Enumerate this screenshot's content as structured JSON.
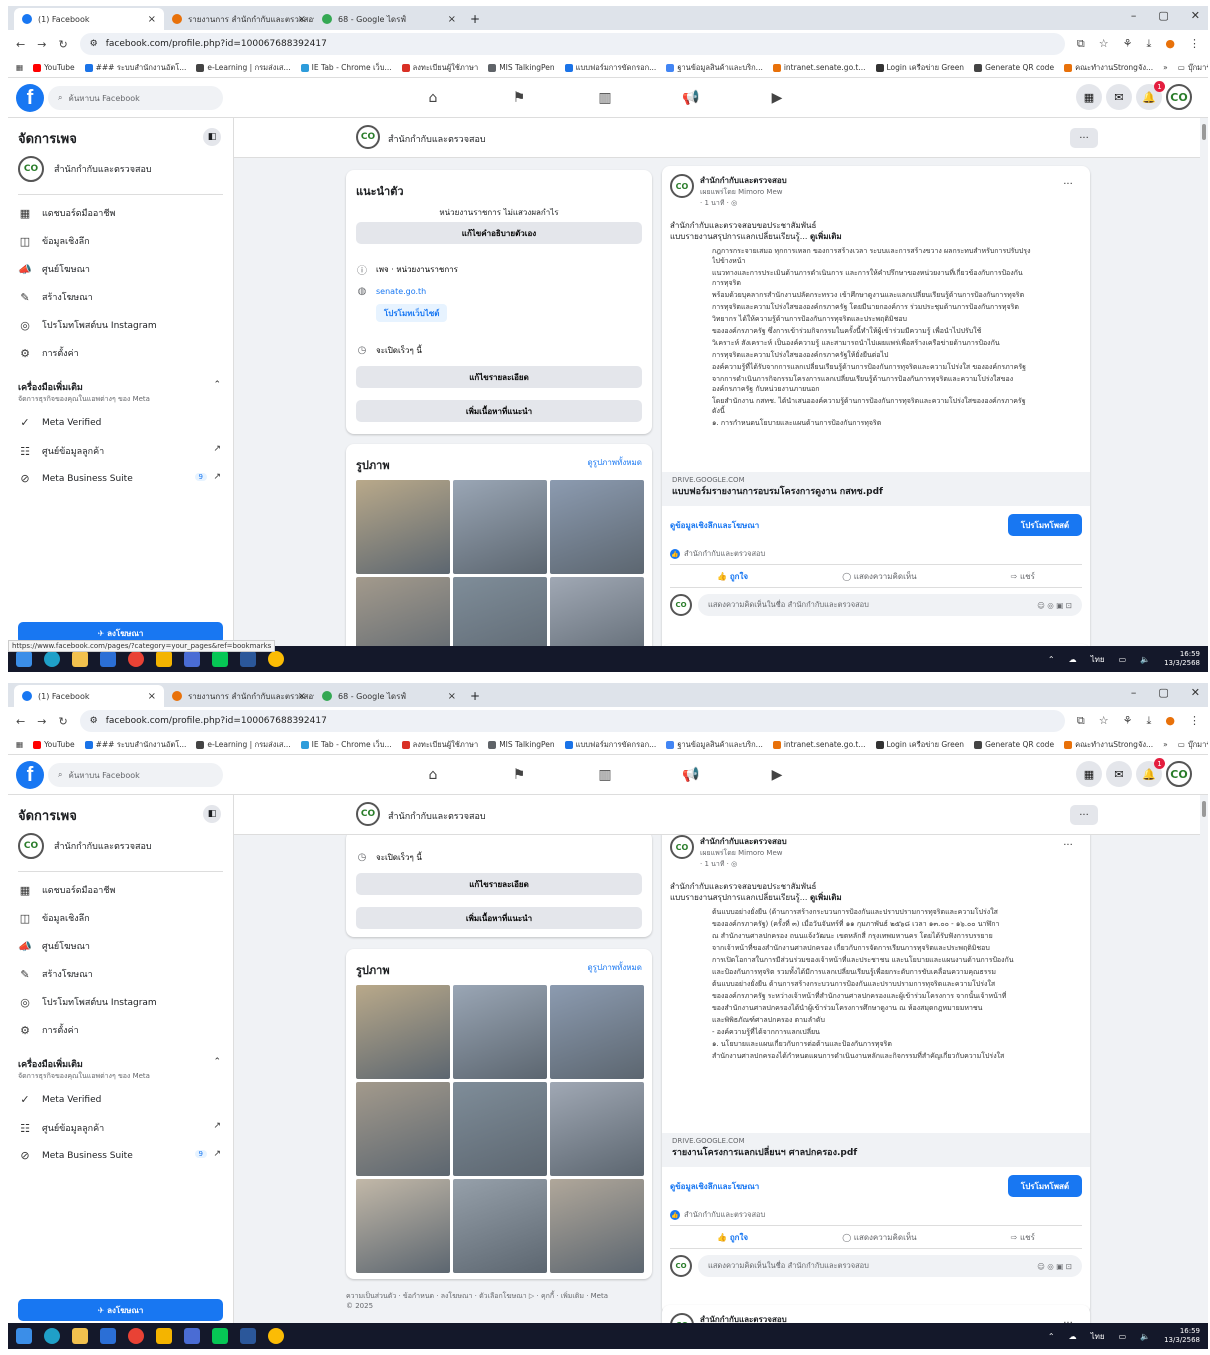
{
  "browser": {
    "tabs": [
      {
        "label": "(1) Facebook",
        "color": "#1877f2"
      },
      {
        "label": "รายงานการ สำนักกำกับและตรวจสอบ 2",
        "color": "#e8710a"
      },
      {
        "label": "68 - Google ไดรฟ์",
        "color": "#34a853"
      }
    ],
    "new_tab": "+",
    "url": "facebook.com/profile.php?id=100067688392417",
    "bookmarks": [
      "YouTube",
      "### ระบบสำนักงานอัตโ...",
      "e-Learning | กรมส่งเส...",
      "IE Tab - Chrome เว็บ...",
      "ลงทะเบียนผู้ใช้ภาษา",
      "MIS TalkingPen",
      "แบบฟอร์มการขัดกรอก...",
      "ฐานข้อมูลสินค้าและบริก...",
      "intranet.senate.go.t...",
      "Login เครือข่าย Green",
      "Generate QR code",
      "คณะทำงานStrongจัง..."
    ],
    "bm_more": "»",
    "bm_folder": "บุ๊กมาร์กทั้งหมด",
    "status_url": "https://www.facebook.com/pages/?category=your_pages&ref=bookmarks"
  },
  "fb": {
    "logo": "f",
    "search_placeholder": "ค้นหาบน Facebook",
    "notif_count": "1"
  },
  "sidebar": {
    "title": "จัดการเพจ",
    "page_name": "สำนักกำกับและตรวจสอบ",
    "items": [
      {
        "label": "แดชบอร์ดมืออาชีพ",
        "icon": "▦"
      },
      {
        "label": "ข้อมูลเชิงลึก",
        "icon": "◫"
      },
      {
        "label": "ศูนย์โฆษณา",
        "icon": "📣"
      },
      {
        "label": "สร้างโฆษณา",
        "icon": "✎"
      },
      {
        "label": "โปรโมทโพสต์บน Instagram",
        "icon": "◎"
      },
      {
        "label": "การตั้งค่า",
        "icon": "⚙"
      }
    ],
    "more_tools": "เครื่องมือเพิ่มเติม",
    "more_tools_sub": "จัดการธุรกิจของคุณในแอพต่างๆ ของ Meta",
    "tools": [
      {
        "label": "Meta Verified",
        "icon": "✓",
        "ext": ""
      },
      {
        "label": "ศูนย์ข้อมูลลูกค้า",
        "icon": "☷",
        "ext": "↗"
      },
      {
        "label": "Meta Business Suite",
        "icon": "⊘",
        "ext": "↗",
        "badge": "9"
      }
    ],
    "advertise": "ลงโฆษณา"
  },
  "intro": {
    "title": "แนะนำตัว",
    "category": "หน่วยงานราชการ ไม่แสวงผลกำไร",
    "edit_bio": "แก้ไขคำอธิบายตัวเอง",
    "page_type": "เพจ · หน่วยงานราชการ",
    "website": "senate.go.th",
    "promote_web": "โปรโมทเว็บไซต์",
    "hours": "จะเปิดเร็วๆ นี้",
    "edit_details": "แก้ไขรายละเอียด",
    "add_featured": "เพิ่มเนื้อหาที่แนะนำ"
  },
  "photos": {
    "title": "รูปภาพ",
    "see_all": "ดูรูปภาพทั้งหมด",
    "tones": [
      "#b9a98a",
      "#9aa6b5",
      "#8c9bb0",
      "#a39a8c",
      "#7f8d99",
      "#a0a8b4",
      "#c2b8a8",
      "#96a0aa",
      "#b0a79a"
    ]
  },
  "footer": {
    "links": "ความเป็นส่วนตัว · ข้อกำหนด · ลงโฆษณา · ตัวเลือกโฆษณา ▷ · คุกกี้ · เพิ่มเติม · Meta",
    "copy": "© 2025"
  },
  "posts": [
    {
      "author": "สำนักกำกับและตรวจสอบ",
      "sub": "เผยแพร่โดย Mimoro Mew",
      "time": "· 1 นาที · ◎",
      "text1": "สำนักกำกับและตรวจสอบขอประชาสัมพันธ์",
      "text2": "แบบรายงานสรุปการแลกเปลี่ยนเรียนรู้...",
      "more": "ดูเพิ่มเติม",
      "doc": [
        "กฎการกระจายเสมอ ทุกการเหลก ของการสร้างเวลา ระบบและการสร้างขวาง ผลกระทบสำหรับการปรับปรุงไปข้างหน้า",
        "แนวทางและการประเมินด้านการดำเนินการ และการให้คำปรึกษาของหน่วยงานที่เกี่ยวข้องกับการป้องกันการทุจริต",
        "พร้อมด้วยบุคลากรสำนักงานปลัดกระทรวง เข้าศึกษาดูงานและแลกเปลี่ยนเรียนรู้ด้านการป้องกันการทุจริต",
        "การทุจริตและความโปร่งใสขององค์กรภาครัฐ โดยมีนายกองค์การ ร่วมประชุมด้านการป้องกันการทุจริต",
        "วิทยากร ได้ให้ความรู้ด้านการป้องกันการทุจริตและประพฤติมิชอบ",
        "ขององค์กรภาครัฐ ซึ่งการเข้าร่วมกิจกรรมในครั้งนี้ทำให้ผู้เข้าร่วมมีความรู้ เพื่อนำไปปรับใช้",
        "วิเคราะห์ สังเคราะห์ เป็นองค์ความรู้ และสามารถนำไปเผยแพร่เพื่อสร้างเครือข่ายด้านการป้องกัน",
        "การทุจริตและความโปร่งใสขององค์กรภาครัฐให้ยั่งยืนต่อไป",
        "องค์ความรู้ที่ได้รับจากการแลกเปลี่ยนเรียนรู้ด้านการป้องกันการทุจริตและความโปร่งใส ขององค์กรภาครัฐ",
        "จากการดำเนินการกิจกรรมโครงการแลกเปลี่ยนเรียนรู้ด้านการป้องกันการทุจริตและความโปร่งใสขององค์กรภาครัฐ กับหน่วยงานภายนอก",
        "โดยสำนักงาน กสทช. ได้นำเสนอองค์ความรู้ด้านการป้องกันการทุจริตและความโปร่งใสขององค์กรภาครัฐ ดังนี้",
        "๑. การกำหนดนโยบายและแผนด้านการป้องกันการทุจริต"
      ],
      "domain": "DRIVE.GOOGLE.COM",
      "file": "แบบฟอร์มรายงานการอบรมโครงการดูงาน กสทช.pdf",
      "insights": "ดูข้อมูลเชิงลึกและโฆษณา",
      "promote": "โปรโมทโพสต์",
      "liker": "สำนักกำกับและตรวจสอบ",
      "like": "ถูกใจ",
      "comment": "แสดงความคิดเห็น",
      "share": "แชร์",
      "comment_as": "แสดงความคิดเห็นในชื่อ สำนักกำกับและตรวจสอบ"
    },
    {
      "author": "สำนักกำกับและตรวจสอบ",
      "sub": "เผยแพร่โดย Mimoro Mew",
      "time": "· 1 นาที · ◎",
      "text1": "สำนักกำกับและตรวจสอบขอประชาสัมพันธ์",
      "text2": "แบบรายงานสรุปการแลกเปลี่ยนเรียนรู้...",
      "more": "ดูเพิ่มเติม",
      "doc": [
        "ต้นแบบอย่างยั่งยืน (ด้านการสร้างกระบวนการป้องกันและปราบปรามการทุจริตและความโปร่งใส",
        "ขององค์กรภาครัฐ) (ครั้งที่ ๓) เมื่อวันจันทร์ที่ ๑๑ กุมภาพันธ์ ๒๕๖๘ เวลา ๑๓.๐๐ - ๑๖.๐๐ นาฬิกา",
        "ณ สำนักงานศาลปกครอง ถนนแจ้งวัฒนะ เขตหลักสี่ กรุงเทพมหานคร โดยได้รับฟังการบรรยาย",
        "จากเจ้าหน้าที่ของสำนักงานศาลปกครอง เกี่ยวกับการจัดการเรียนการทุจริตและประพฤติมิชอบ",
        "การเปิดโอกาสในการมีส่วนร่วมของเจ้าหน้าที่และประชาชน และนโยบายและแผนงานด้านการป้องกัน",
        "และป้องกันการทุจริต รวมทั้งได้มีการแลกเปลี่ยนเรียนรู้เพื่อยกระดับการขับเคลื่อนความคุณธรรม",
        "ต้นแบบอย่างยั่งยืน ด้านการสร้างกระบวนการป้องกันและปราบปรามการทุจริตและความโปร่งใส",
        "ขององค์กรภาครัฐ ระหว่างเจ้าหน้าที่สำนักงานศาลปกครองและผู้เข้าร่วมโครงการ จากนั้นเจ้าหน้าที่",
        "ของสำนักงานศาลปกครองได้นำผู้เข้าร่วมโครงการศึกษาดูงาน ณ ห้องสมุดกฎหมายมหาชน",
        "และพิพิธภัณฑ์ศาลปกครอง ตามลำดับ",
        "- องค์ความรู้ที่ได้จากการแลกเปลี่ยน",
        "๑. นโยบายและแผนเกี่ยวกับการต่อต้านและป้องกันการทุจริต",
        "สำนักงานศาลปกครองได้กำหนดแผนการดำเนินงานหลักและกิจกรรมที่สำคัญเกี่ยวกับความโปร่งใส"
      ],
      "domain": "DRIVE.GOOGLE.COM",
      "file": "รายงานโครงการแลกเปลี่ยนฯ ศาลปกครอง.pdf",
      "insights": "ดูข้อมูลเชิงลึกและโฆษณา",
      "promote": "โปรโมทโพสต์",
      "liker": "สำนักกำกับและตรวจสอบ",
      "like": "ถูกใจ",
      "comment": "แสดงความคิดเห็น",
      "share": "แชร์",
      "comment_as": "แสดงความคิดเห็นในชื่อ สำนักกำกับและตรวจสอบ"
    }
  ],
  "next_post": {
    "author": "สำนักกำกับและตรวจสอบ",
    "sub": "เผยแพร่โดย Mimoro Mew"
  },
  "taskbar": {
    "lang": "ไทย",
    "time": "16:59",
    "date": "13/3/2568"
  }
}
